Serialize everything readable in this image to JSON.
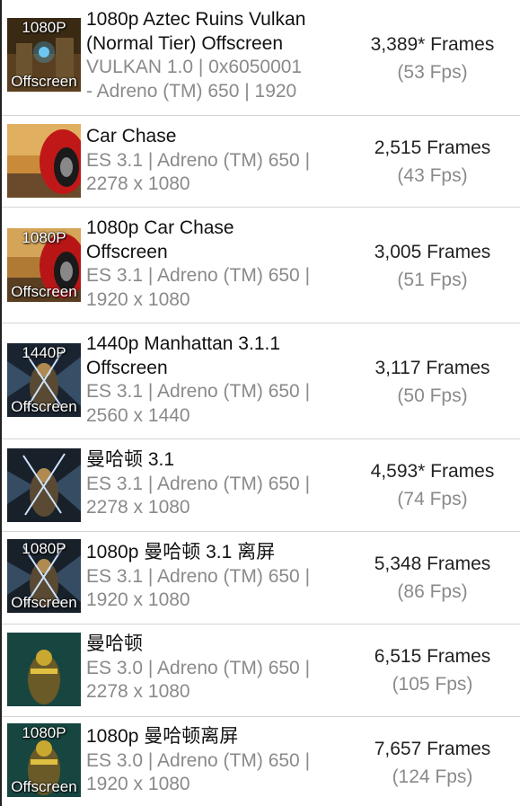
{
  "tests": [
    {
      "thumb_top": "1080P",
      "thumb_bottom": "Offscreen",
      "thumb_icon": "aztec-ruins-thumbnail",
      "title_lines": [
        "1080p Aztec Ruins Vulkan",
        "(Normal Tier) Offscreen"
      ],
      "sub_lines": [
        "VULKAN 1.0 | 0x6050001",
        "- Adreno (TM) 650 | 1920"
      ],
      "frames": "3,389* Frames",
      "fps": "(53 Fps)"
    },
    {
      "thumb_top": "",
      "thumb_bottom": "",
      "thumb_icon": "car-chase-thumbnail",
      "title_lines": [
        "Car Chase"
      ],
      "sub_lines": [
        "ES 3.1 | Adreno (TM) 650 |",
        "2278 x 1080"
      ],
      "frames": "2,515 Frames",
      "fps": "(43 Fps)"
    },
    {
      "thumb_top": "1080P",
      "thumb_bottom": "Offscreen",
      "thumb_icon": "car-chase-thumbnail",
      "title_lines": [
        "1080p Car Chase",
        "Offscreen"
      ],
      "sub_lines": [
        "ES 3.1 | Adreno (TM) 650 |",
        "1920 x 1080"
      ],
      "frames": "3,005 Frames",
      "fps": "(51 Fps)"
    },
    {
      "thumb_top": "1440P",
      "thumb_bottom": "Offscreen",
      "thumb_icon": "manhattan-thumbnail",
      "title_lines": [
        "1440p Manhattan 3.1.1",
        "Offscreen"
      ],
      "sub_lines": [
        "ES 3.1 | Adreno (TM) 650 |",
        "2560 x 1440"
      ],
      "frames": "3,117 Frames",
      "fps": "(50 Fps)"
    },
    {
      "thumb_top": "",
      "thumb_bottom": "",
      "thumb_icon": "manhattan-thumbnail",
      "title_lines": [
        "曼哈顿 3.1"
      ],
      "sub_lines": [
        "ES 3.1 | Adreno (TM) 650 |",
        "2278 x 1080"
      ],
      "frames": "4,593* Frames",
      "fps": "(74 Fps)"
    },
    {
      "thumb_top": "1080P",
      "thumb_bottom": "Offscreen",
      "thumb_icon": "manhattan-thumbnail",
      "title_lines": [
        "1080p 曼哈顿 3.1 离屏"
      ],
      "sub_lines": [
        "ES 3.1 | Adreno (TM) 650 |",
        "1920 x 1080"
      ],
      "frames": "5,348 Frames",
      "fps": "(86 Fps)"
    },
    {
      "thumb_top": "",
      "thumb_bottom": "",
      "thumb_icon": "manhattan-robot-thumbnail",
      "title_lines": [
        "曼哈顿"
      ],
      "sub_lines": [
        "ES 3.0 | Adreno (TM) 650 |",
        "2278 x 1080"
      ],
      "frames": "6,515 Frames",
      "fps": "(105 Fps)"
    },
    {
      "thumb_top": "1080P",
      "thumb_bottom": "Offscreen",
      "thumb_icon": "manhattan-robot-thumbnail",
      "title_lines": [
        "1080p 曼哈顿离屏"
      ],
      "sub_lines": [
        "ES 3.0 | Adreno (TM) 650 |",
        "1920 x 1080"
      ],
      "frames": "7,657 Frames",
      "fps": "(124 Fps)"
    }
  ]
}
